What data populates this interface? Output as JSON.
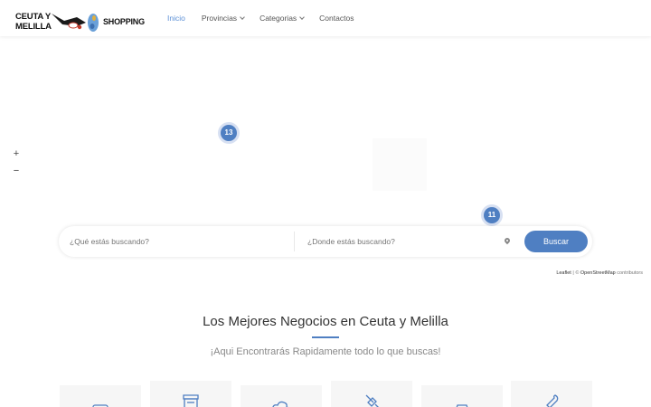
{
  "brand": {
    "line1": "CEUTA Y",
    "line2": "MELILLA",
    "line3": "SHOPPING"
  },
  "nav": {
    "items": [
      {
        "label": "Inicio",
        "active": true,
        "has_dropdown": false
      },
      {
        "label": "Provincias",
        "active": false,
        "has_dropdown": true
      },
      {
        "label": "Categorias",
        "active": false,
        "has_dropdown": true
      },
      {
        "label": "Contactos",
        "active": false,
        "has_dropdown": false
      }
    ]
  },
  "map": {
    "zoom_in": "+",
    "zoom_out": "−",
    "clusters": [
      {
        "count": "13"
      },
      {
        "count": "11"
      }
    ],
    "attribution": {
      "leaflet": "Leaflet",
      "separator": " | © ",
      "osm": "OpenStreetMap",
      "contributors": " contributors"
    }
  },
  "search": {
    "what_placeholder": "¿Qué estás buscando?",
    "where_placeholder": "¿Donde estás buscando?",
    "button_label": "Buscar"
  },
  "headline": {
    "title": "Los Mejores Negocios en Ceuta y Melilla",
    "subtitle": "¡Aqui Encontrarás Rapidamente todo lo que buscas!"
  },
  "categories": [
    {
      "icon": "box-icon"
    },
    {
      "icon": "store-icon"
    },
    {
      "icon": "cloud-icon"
    },
    {
      "icon": "wrench-brush-icon"
    },
    {
      "icon": "car-icon"
    },
    {
      "icon": "wrench-icon"
    }
  ],
  "colors": {
    "accent": "#4f7fc2",
    "active_nav": "#5b8fd6"
  }
}
